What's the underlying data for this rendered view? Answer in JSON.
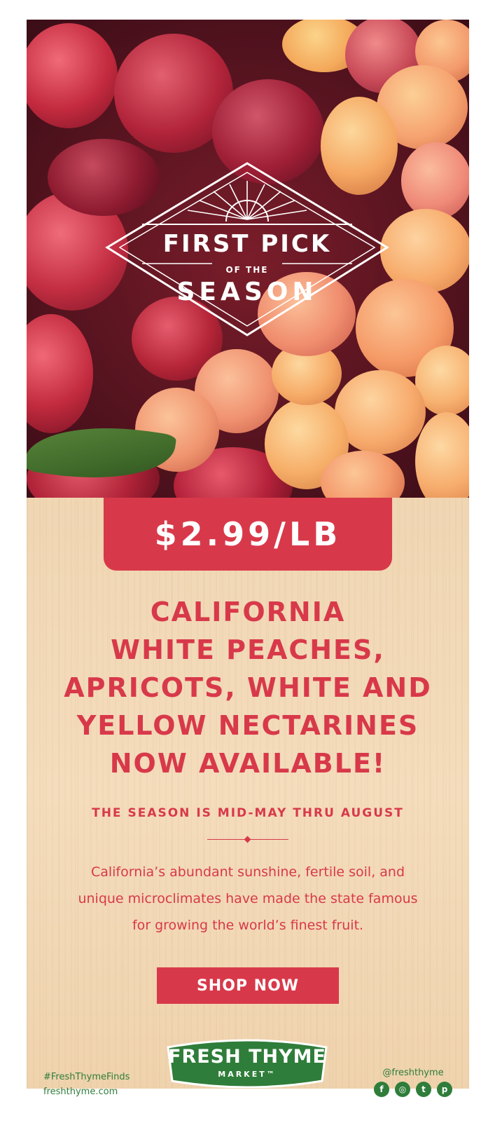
{
  "hero": {
    "badge_line1": "FIRST PICK",
    "badge_line2": "OF THE",
    "badge_line3": "SEASON"
  },
  "price": "$2.99/LB",
  "headline": [
    "CALIFORNIA",
    "WHITE PEACHES,",
    "APRICOTS, WHITE AND",
    "YELLOW NECTARINES",
    "NOW AVAILABLE!"
  ],
  "season_note": "THE SEASON IS MID-MAY THRU AUGUST",
  "body_lines": [
    "California’s abundant sunshine, fertile soil, and",
    "unique microclimates have made the state famous",
    "for growing the world’s finest fruit."
  ],
  "cta_label": "SHOP NOW",
  "logo": {
    "name": "FRESH THYME",
    "sub": "MARKET™"
  },
  "footer": {
    "hashtag": "#FreshThymeFinds",
    "site": "freshthyme.com",
    "handle": "@freshthyme"
  },
  "social_icons": [
    {
      "name": "facebook-icon",
      "glyph": "f"
    },
    {
      "name": "instagram-icon",
      "glyph": "◎"
    },
    {
      "name": "twitter-icon",
      "glyph": "t"
    },
    {
      "name": "pinterest-icon",
      "glyph": "p"
    }
  ],
  "colors": {
    "accent_red": "#d8394a",
    "brand_green": "#2f7d3a",
    "wood": "#f2d8b7"
  }
}
